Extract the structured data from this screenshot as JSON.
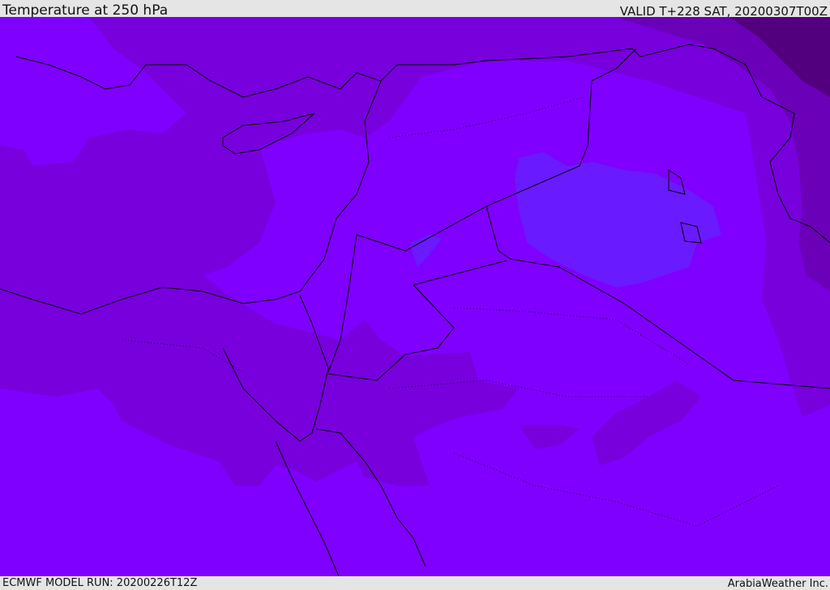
{
  "header": {
    "title": "Temperature at 250 hPa",
    "valid": "VALID T+228 SAT, 20200307T00Z"
  },
  "footer": {
    "model_run": "ECMWF MODEL RUN: 20200226T12Z",
    "brand": "ArabiaWeather Inc."
  },
  "map": {
    "colors": {
      "base": "#7f00ff",
      "warm": "#7700dd",
      "cool": "#6a1aff",
      "dark": "#6a00b8",
      "darkest": "#52007e",
      "coast": "#000000"
    }
  }
}
